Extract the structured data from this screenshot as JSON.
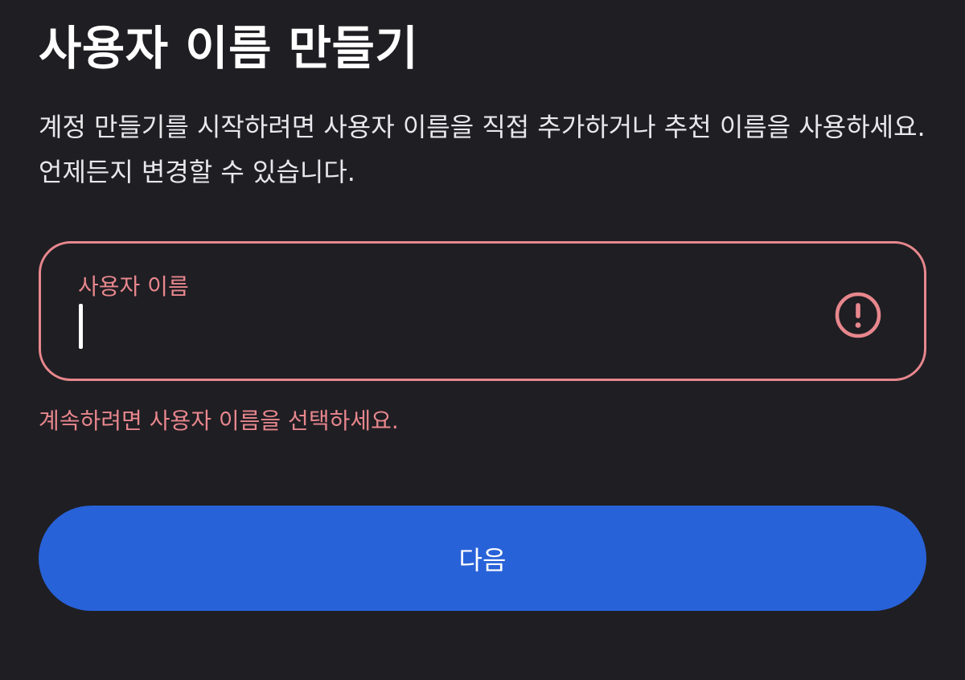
{
  "page": {
    "title": "사용자 이름 만들기",
    "description": "계정 만들기를 시작하려면 사용자 이름을 직접 추가하거나 추천 이름을 사용하세요. 언제든지 변경할 수 있습니다."
  },
  "username_field": {
    "label": "사용자 이름",
    "value": "",
    "icon": "alert-circle-icon",
    "error_text": "계속하려면 사용자 이름을 선택하세요."
  },
  "actions": {
    "next_label": "다음"
  },
  "colors": {
    "background": "#1f1e23",
    "error": "#e7878d",
    "primary": "#2862d8",
    "text": "#ffffff"
  }
}
